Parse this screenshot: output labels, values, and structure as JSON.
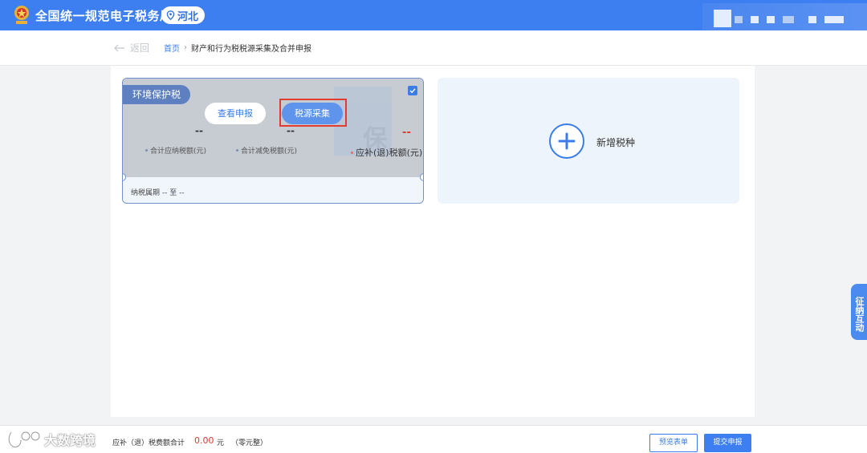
{
  "header": {
    "title": "全国统一规范电子税务局",
    "region": "河北",
    "emblem_icon": "tax-emblem-icon",
    "location_icon": "location-pin-icon"
  },
  "breadcrumb": {
    "back_label": "返回",
    "home": "首页",
    "separator": "›",
    "current": "财产和行为税税源采集及合并申报"
  },
  "tax_card": {
    "tag": "环境保护税",
    "selected": true,
    "view_button": "查看申报",
    "collect_button": "税源采集",
    "watermark_char": "保",
    "stats": [
      {
        "value": "--",
        "label": "合计应纳税额(元)"
      },
      {
        "value": "--",
        "label": "合计减免税额(元)"
      },
      {
        "value": "--",
        "label": "应补(退)税额(元)"
      }
    ],
    "period_label": "纳税属期",
    "period_start": "--",
    "period_to": "至",
    "period_end": "--"
  },
  "add_card": {
    "label": "新增税种"
  },
  "side_tab": {
    "label": "征纳互动"
  },
  "footer": {
    "brand": "大数跨境",
    "total_label": "应补（退）税费额合计",
    "total_value": "0.00",
    "total_unit": "元",
    "total_words": "（零元整）",
    "preview_button": "预览表单",
    "submit_button": "提交申报"
  },
  "colors": {
    "brand_blue": "#3d7ff0",
    "accent_red": "#e03a2c",
    "highlight_box": "#e33b30"
  }
}
